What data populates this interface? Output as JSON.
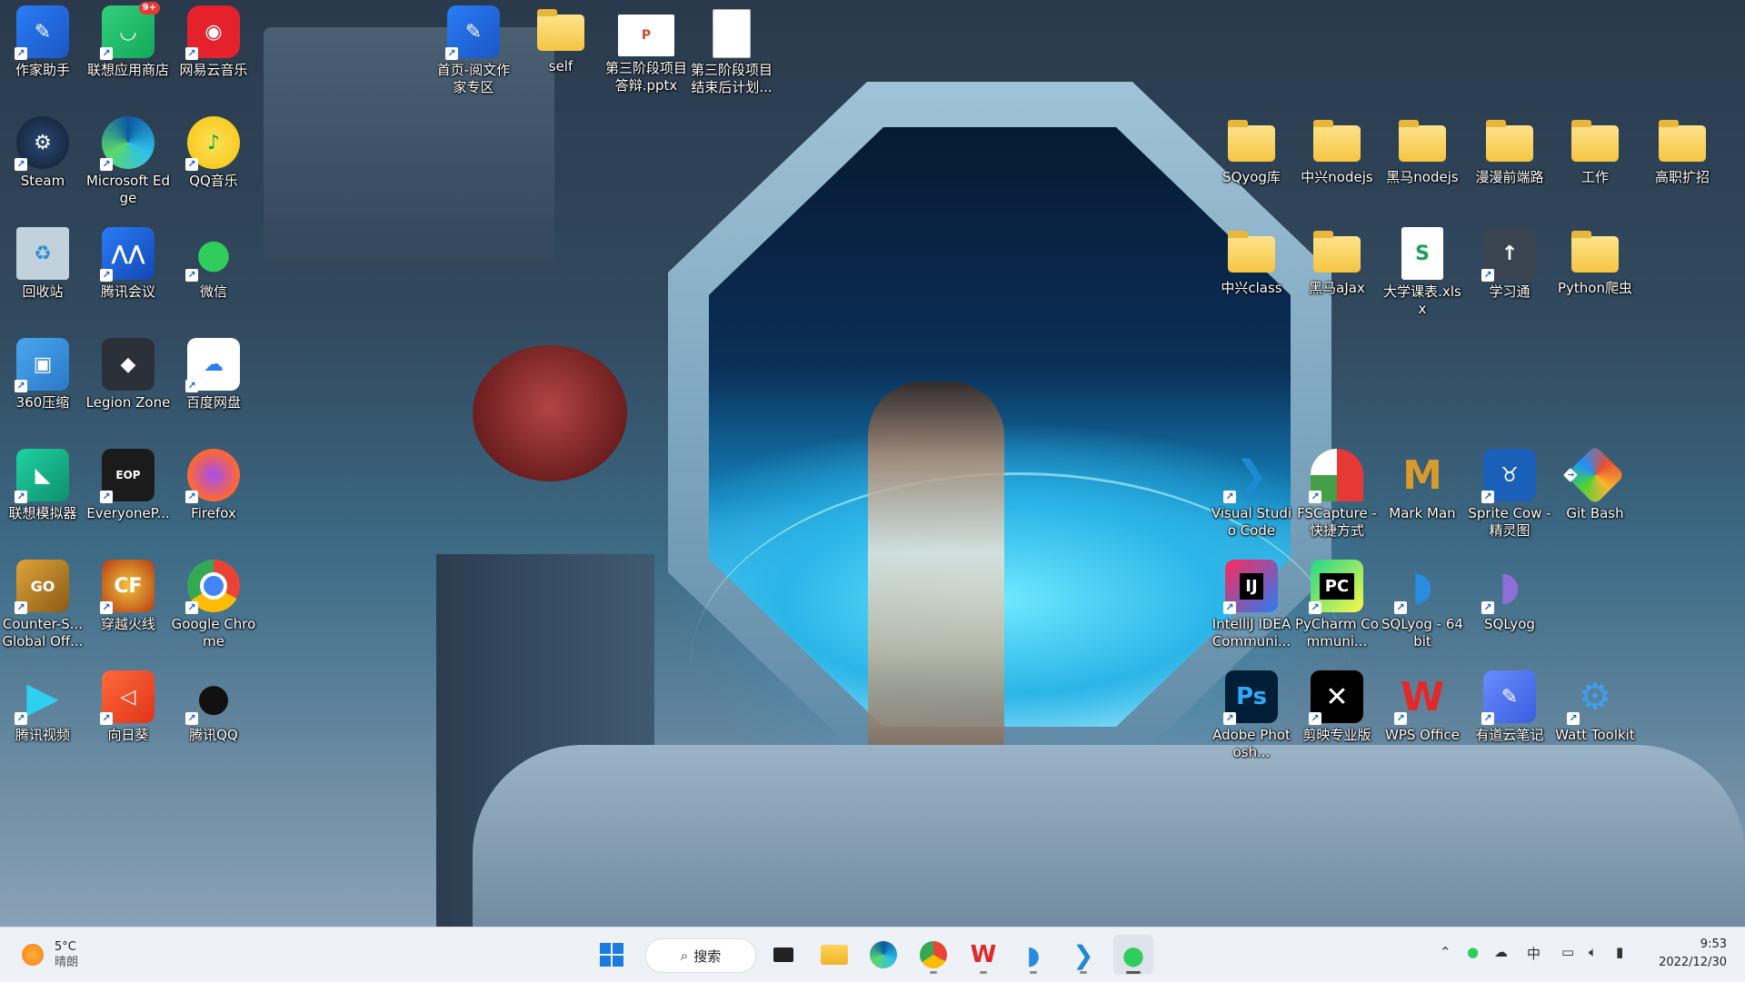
{
  "desktop_icons": {
    "zuojia": {
      "label": "作家助手"
    },
    "lenovo_store": {
      "label": "联想应用商店",
      "badge": "9+"
    },
    "netease_music": {
      "label": "网易云音乐"
    },
    "yuewen": {
      "label": "首页-阅文作家专区"
    },
    "self": {
      "label": "self"
    },
    "pptx": {
      "label": "第三阶段项目答辩.pptx"
    },
    "plan": {
      "label": "第三阶段项目结束后计划..."
    },
    "steam": {
      "label": "Steam"
    },
    "edge": {
      "label": "Microsoft Edge"
    },
    "qqmusic": {
      "label": "QQ音乐"
    },
    "recycle": {
      "label": "回收站"
    },
    "tencent_meeting": {
      "label": "腾讯会议"
    },
    "wechat": {
      "label": "微信"
    },
    "zip360": {
      "label": "360压缩"
    },
    "legion": {
      "label": "Legion Zone"
    },
    "baidu": {
      "label": "百度网盘"
    },
    "emulator": {
      "label": "联想模拟器"
    },
    "everyone": {
      "label": "EveryoneP..."
    },
    "firefox": {
      "label": "Firefox"
    },
    "csgo": {
      "label": "Counter-S... Global Off..."
    },
    "cf": {
      "label": "穿越火线"
    },
    "chrome": {
      "label": "Google Chrome"
    },
    "tencent_video": {
      "label": "腾讯视频"
    },
    "sunflower": {
      "label": "向日葵"
    },
    "qq": {
      "label": "腾讯QQ"
    },
    "sqyog": {
      "label": "SQyog库"
    },
    "zx_nodejs": {
      "label": "中兴nodejs"
    },
    "hm_nodejs": {
      "label": "黑马nodejs"
    },
    "frontend": {
      "label": "漫漫前端路"
    },
    "work": {
      "label": "工作"
    },
    "salary": {
      "label": "高职扩招"
    },
    "zx_class": {
      "label": "中兴class"
    },
    "hm_ajax": {
      "label": "黑马aJax"
    },
    "schedule": {
      "label": "大学课表.xlsx"
    },
    "xuexitong": {
      "label": "学习通"
    },
    "python": {
      "label": "Python爬虫"
    },
    "vscode": {
      "label": "Visual Studio Code"
    },
    "fscapture": {
      "label": "FSCapture - 快捷方式"
    },
    "markman": {
      "label": "Mark Man"
    },
    "spritecow": {
      "label": "Sprite Cow - 精灵图"
    },
    "gitbash": {
      "label": "Git Bash"
    },
    "idea": {
      "label": "IntelliJ IDEA Communi..."
    },
    "pycharm": {
      "label": "PyCharm Communi..."
    },
    "sqlyog64": {
      "label": "SQLyog - 64 bit"
    },
    "sqlyog": {
      "label": "SQLyog"
    },
    "ps": {
      "label": "Adobe Photosh..."
    },
    "capcut": {
      "label": "剪映专业版"
    },
    "wps": {
      "label": "WPS Office"
    },
    "youdao": {
      "label": "有道云笔记"
    },
    "watt": {
      "label": "Watt Toolkit"
    }
  },
  "taskbar": {
    "weather_temp": "5°C",
    "weather_desc": "晴朗",
    "search_label": "搜索",
    "tray_ime": "中",
    "clock_time": "9:53",
    "clock_date": "2022/12/30"
  }
}
